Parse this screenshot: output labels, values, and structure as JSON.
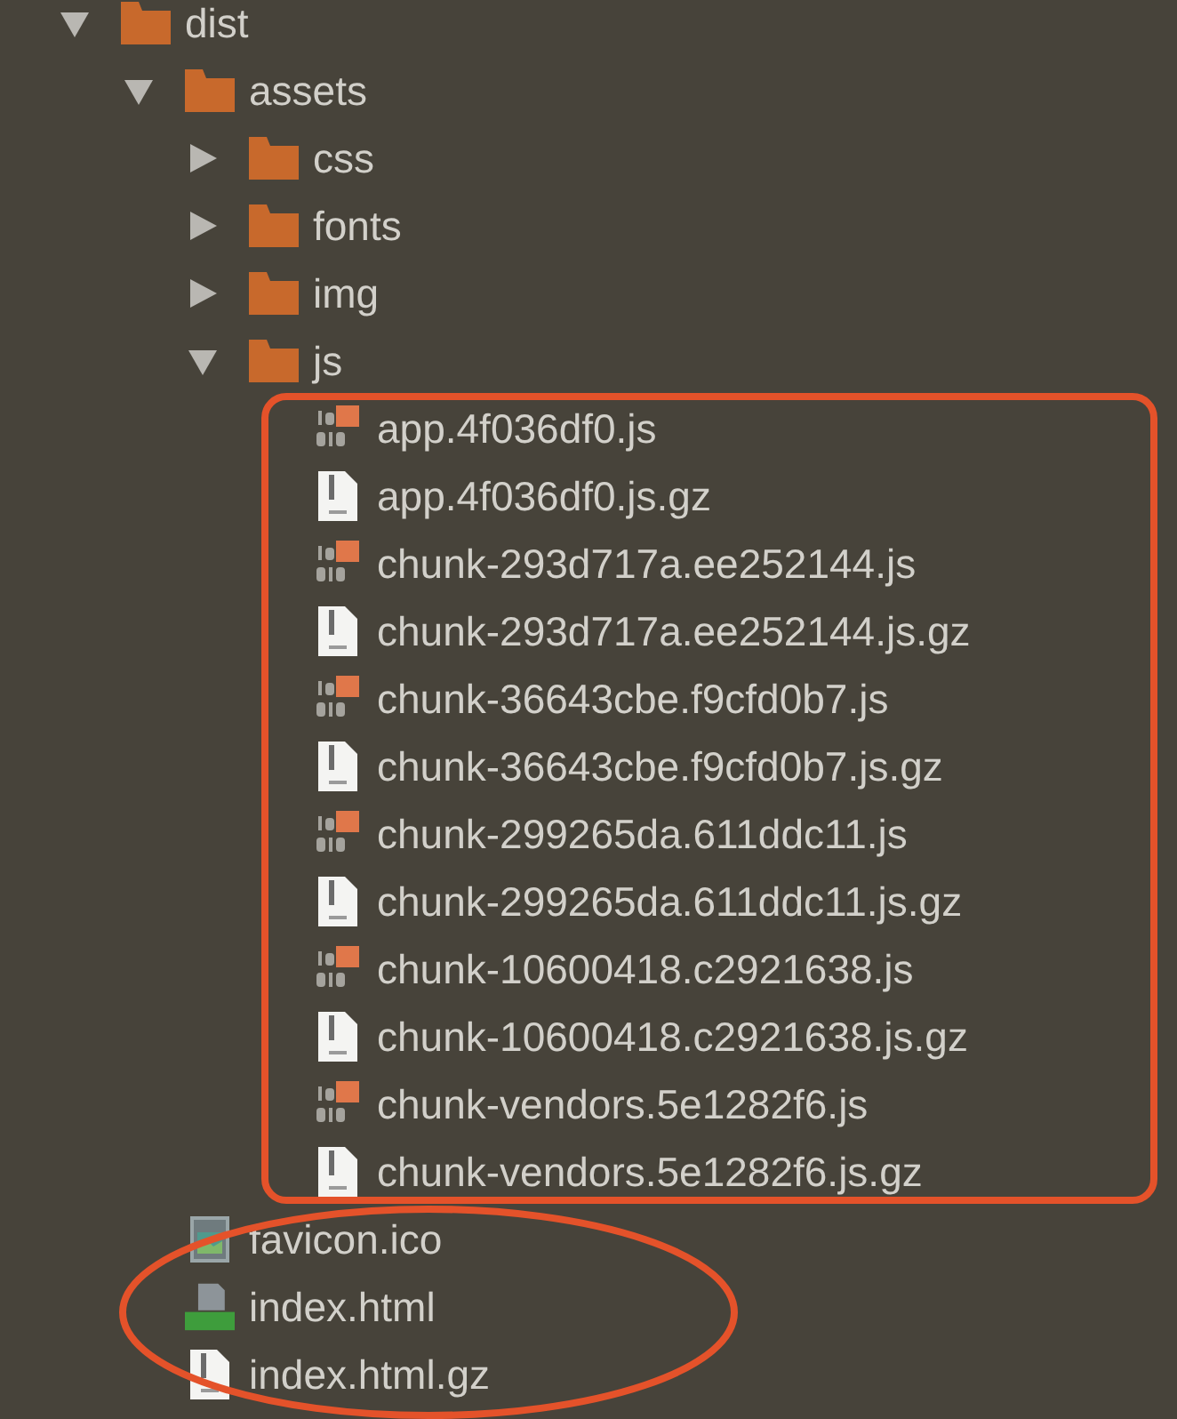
{
  "tree": [
    {
      "kind": "folder",
      "name": "dist",
      "expanded": true,
      "children": [
        {
          "kind": "folder",
          "name": "assets",
          "expanded": true,
          "children": [
            {
              "kind": "folder",
              "name": "css",
              "expanded": false
            },
            {
              "kind": "folder",
              "name": "fonts",
              "expanded": false
            },
            {
              "kind": "folder",
              "name": "img",
              "expanded": false
            },
            {
              "kind": "folder",
              "name": "js",
              "expanded": true,
              "children": [
                {
                  "kind": "js",
                  "name": "app.4f036df0.js"
                },
                {
                  "kind": "gz",
                  "name": "app.4f036df0.js.gz"
                },
                {
                  "kind": "js",
                  "name": "chunk-293d717a.ee252144.js"
                },
                {
                  "kind": "gz",
                  "name": "chunk-293d717a.ee252144.js.gz"
                },
                {
                  "kind": "js",
                  "name": "chunk-36643cbe.f9cfd0b7.js"
                },
                {
                  "kind": "gz",
                  "name": "chunk-36643cbe.f9cfd0b7.js.gz"
                },
                {
                  "kind": "js",
                  "name": "chunk-299265da.611ddc11.js"
                },
                {
                  "kind": "gz",
                  "name": "chunk-299265da.611ddc11.js.gz"
                },
                {
                  "kind": "js",
                  "name": "chunk-10600418.c2921638.js"
                },
                {
                  "kind": "gz",
                  "name": "chunk-10600418.c2921638.js.gz"
                },
                {
                  "kind": "js",
                  "name": "chunk-vendors.5e1282f6.js"
                },
                {
                  "kind": "gz",
                  "name": "chunk-vendors.5e1282f6.js.gz"
                }
              ]
            }
          ]
        },
        {
          "kind": "image",
          "name": "favicon.ico"
        },
        {
          "kind": "html",
          "name": "index.html"
        },
        {
          "kind": "gz",
          "name": "index.html.gz"
        }
      ]
    }
  ]
}
